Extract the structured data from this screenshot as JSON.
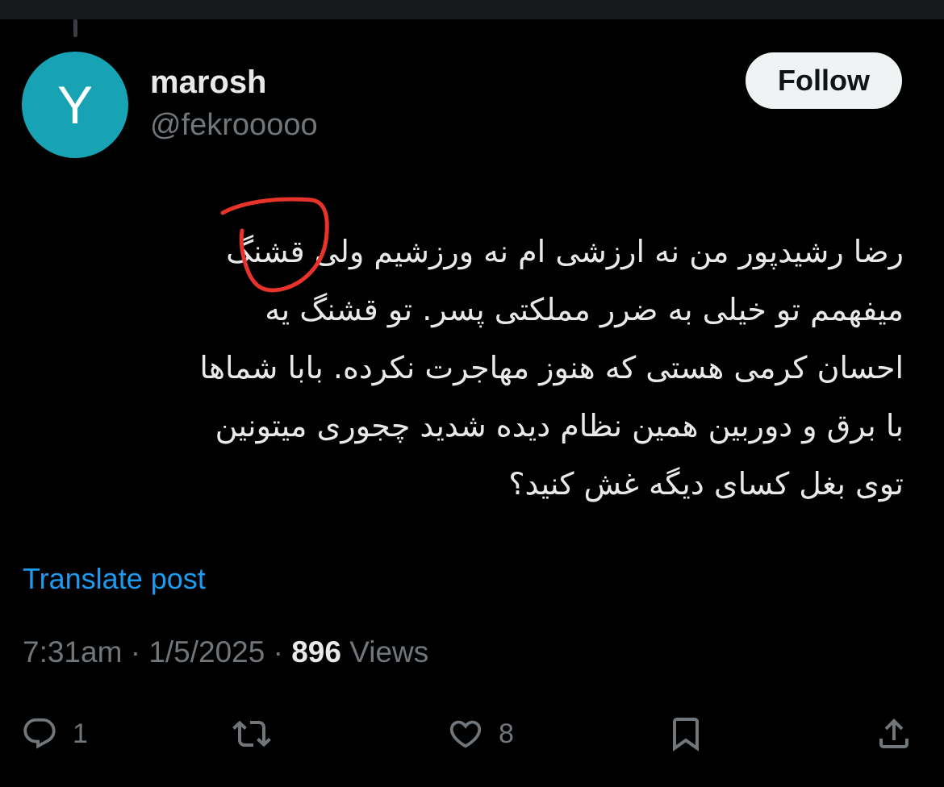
{
  "author": {
    "avatar_letter": "Y",
    "avatar_color": "#17a3b3",
    "display_name": "marosh",
    "handle": "@fekrooooo"
  },
  "follow_label": "Follow",
  "tweet": {
    "text": "رضا رشیدپور من نه ارزشی ام نه ورزشیم ولی قشنگ\nمیفهمم تو خیلی به ضرر مملکتی پسر. تو قشنگ یه\nاحسان کرمی هستی که هنوز مهاجرت نکرده. بابا شماها\nبا برق و دوربین همین نظام دیده شدید چجوری میتونین\nتوی بغل کسای دیگه غش کنید؟"
  },
  "translate_label": "Translate post",
  "meta": {
    "time": "7:31am",
    "separator": "·",
    "date": "1/5/2025",
    "views_count": "896",
    "views_label": "Views"
  },
  "actions": {
    "reply_count": "1",
    "like_count": "8"
  },
  "icons": [
    "reply-icon",
    "retweet-icon",
    "like-icon",
    "bookmark-icon",
    "share-icon"
  ],
  "colors": {
    "background": "#000000",
    "accent": "#1d9bf0",
    "muted": "#71767b",
    "annotation": "#e8332b"
  }
}
